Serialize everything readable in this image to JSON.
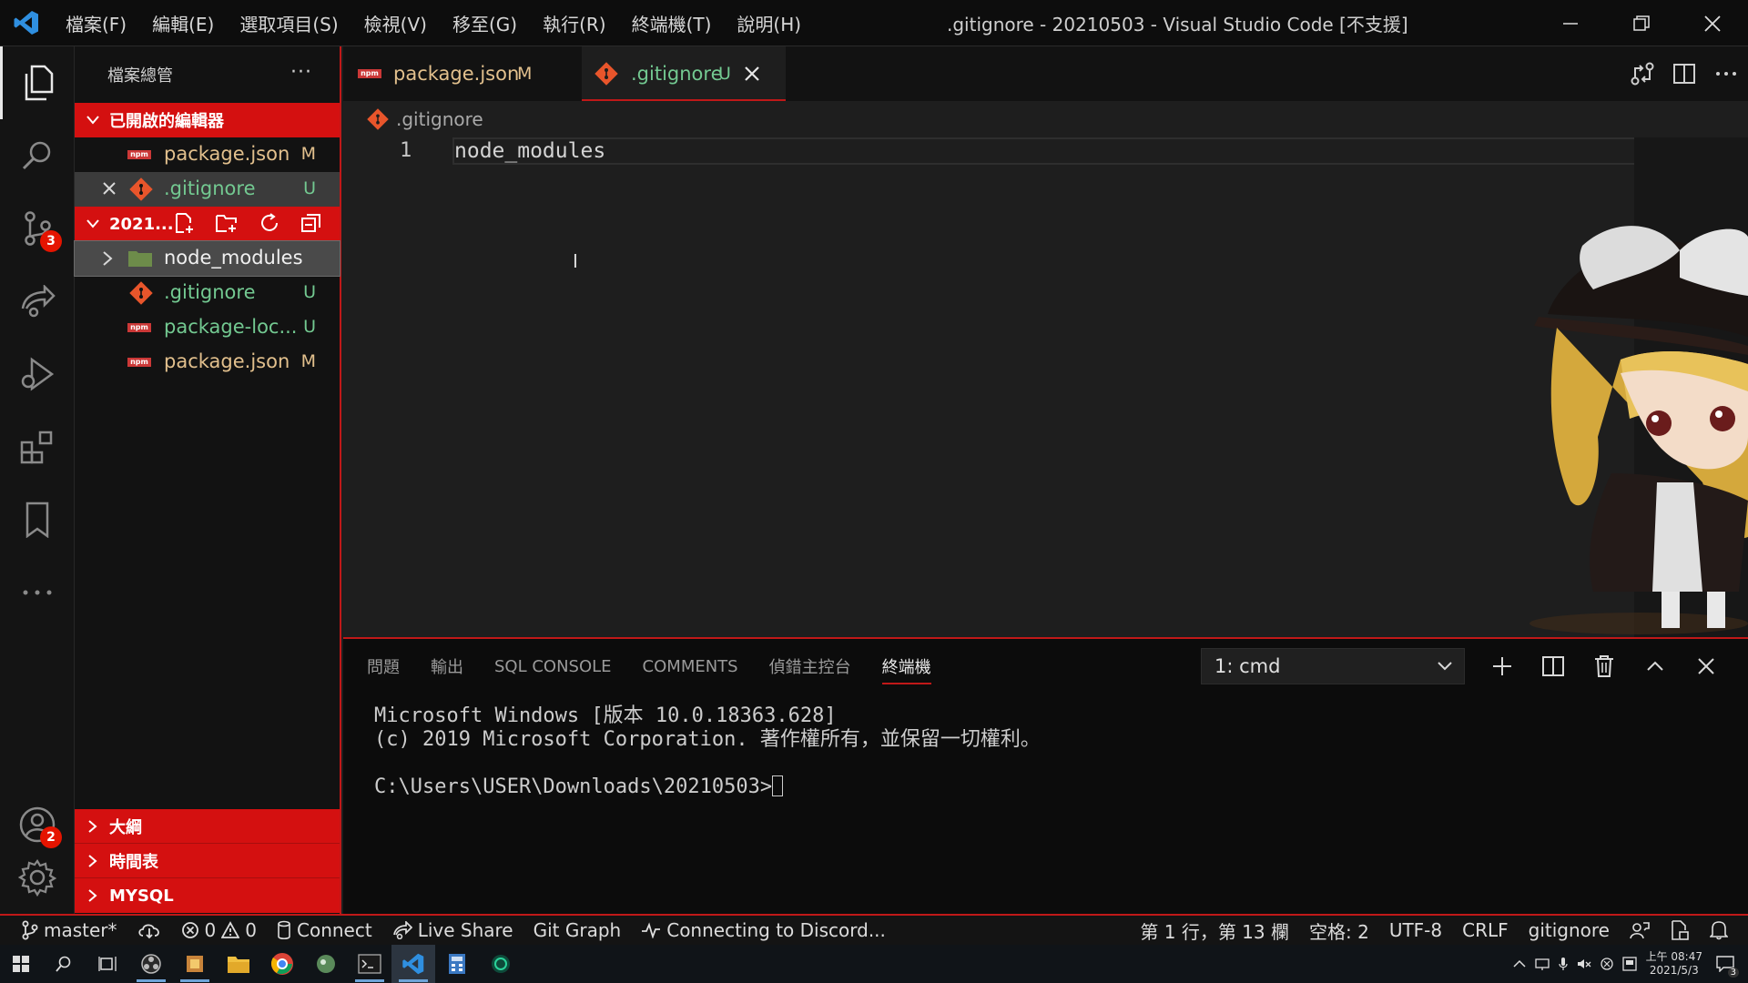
{
  "titlebar": {
    "menu": [
      "檔案(F)",
      "編輯(E)",
      "選取項目(S)",
      "檢視(V)",
      "移至(G)",
      "執行(R)",
      "終端機(T)",
      "說明(H)"
    ],
    "window_title": ".gitignore - 20210503 - Visual Studio Code [不支援]"
  },
  "activitybar": {
    "source_control_badge": "3",
    "accounts_badge": "2"
  },
  "sidebar": {
    "title": "檔案總管",
    "more": "···",
    "open_editors": {
      "label": "已開啟的編輯器",
      "items": [
        {
          "name": "package.json",
          "status": "M"
        },
        {
          "name": ".gitignore",
          "status": "U"
        }
      ]
    },
    "folder": {
      "label": "2021...",
      "items": [
        {
          "name": "node_modules",
          "status": ""
        },
        {
          "name": ".gitignore",
          "status": "U"
        },
        {
          "name": "package-loc...",
          "status": "U"
        },
        {
          "name": "package.json",
          "status": "M"
        }
      ]
    },
    "outline": "大綱",
    "timeline": "時間表",
    "mysql": "MYSQL"
  },
  "tabs": [
    {
      "name": "package.json",
      "status": "M"
    },
    {
      "name": ".gitignore",
      "status": "U"
    }
  ],
  "breadcrumb": ".gitignore",
  "editor": {
    "line_number": "1",
    "code": "node_modules"
  },
  "panel": {
    "tabs": [
      "問題",
      "輸出",
      "SQL CONSOLE",
      "COMMENTS",
      "偵錯主控台",
      "終端機"
    ],
    "terminal_select": "1: cmd",
    "terminal_lines": [
      "Microsoft Windows [版本 10.0.18363.628]",
      "(c) 2019 Microsoft Corporation. 著作權所有，並保留一切權利。",
      "",
      "C:\\Users\\USER\\Downloads\\20210503>"
    ]
  },
  "statusbar": {
    "branch": "master*",
    "errors": "0",
    "warnings": "0",
    "connect": "Connect",
    "live_share": "Live Share",
    "git_graph": "Git Graph",
    "discord": "Connecting to Discord...",
    "position": "第 1 行，第 13 欄",
    "spaces": "空格: 2",
    "encoding": "UTF-8",
    "eol": "CRLF",
    "language": "gitignore"
  },
  "taskbar": {
    "time": "上午 08:47",
    "date": "2021/5/3",
    "notifications": "3"
  }
}
